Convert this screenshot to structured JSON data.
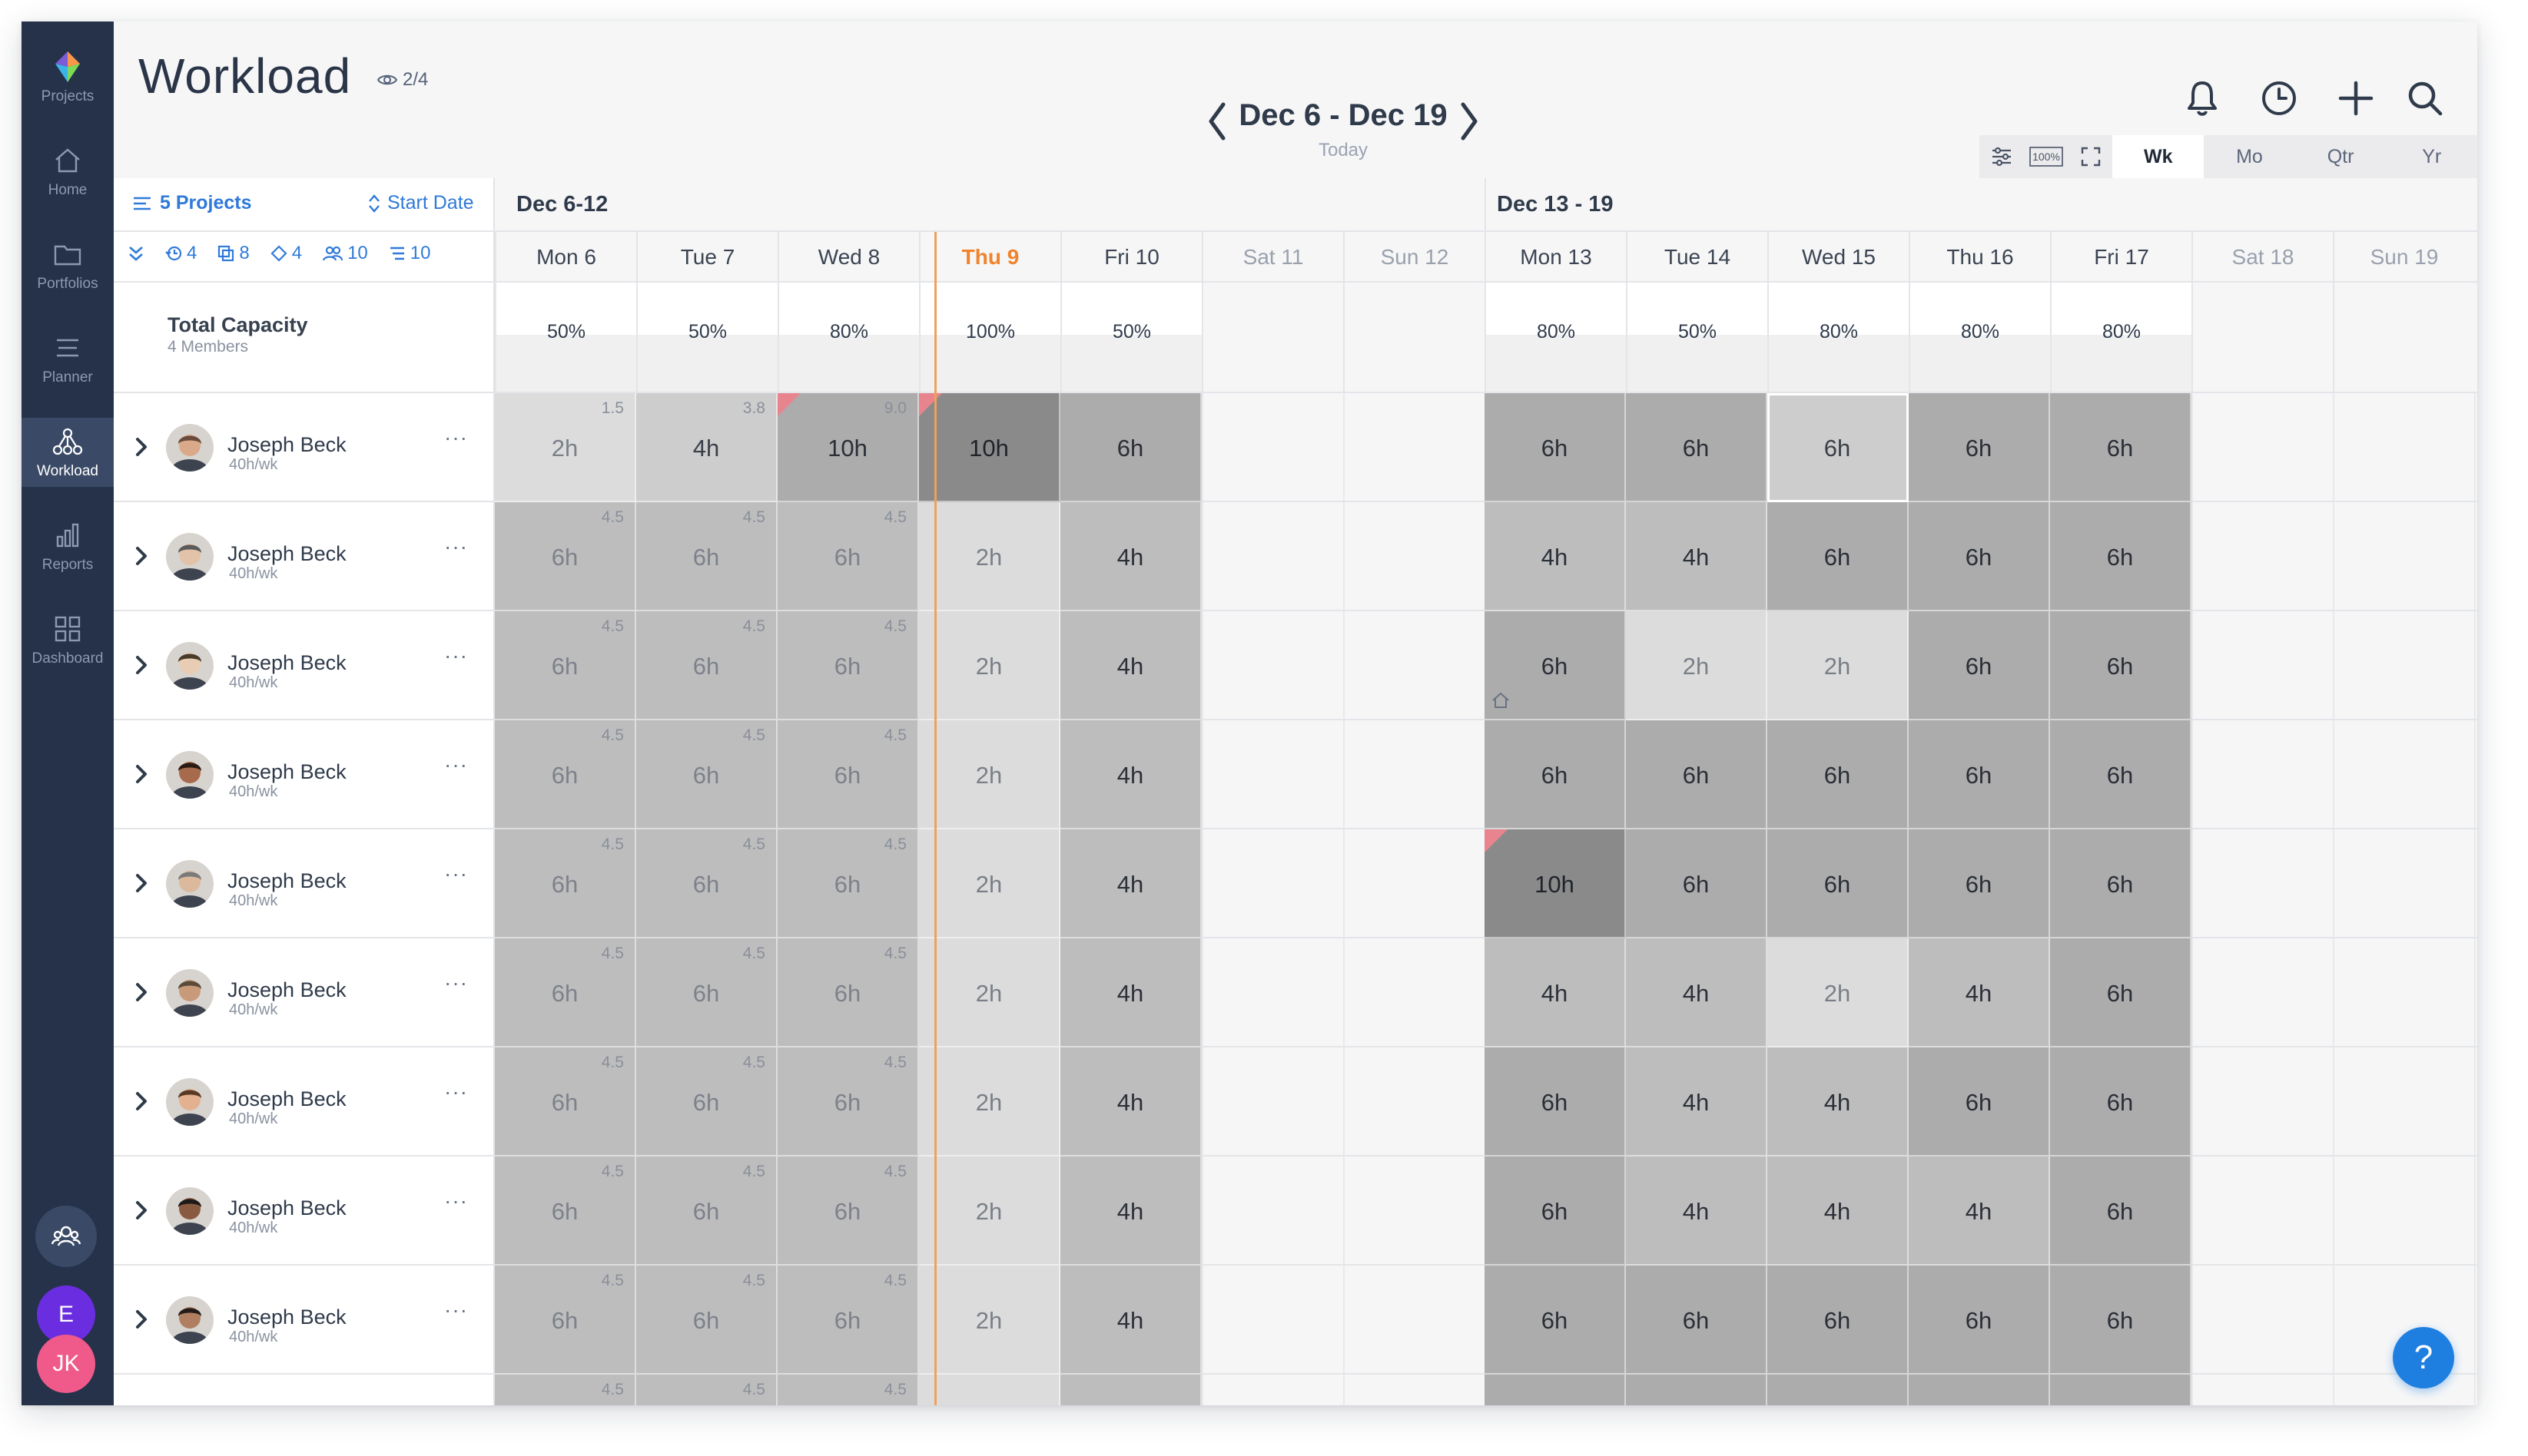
{
  "sidebar": {
    "items": [
      {
        "label": "Projects",
        "icon": "projects-logo-icon"
      },
      {
        "label": "Home",
        "icon": "home-icon"
      },
      {
        "label": "Portfolios",
        "icon": "folder-icon"
      },
      {
        "label": "Planner",
        "icon": "planner-icon"
      },
      {
        "label": "Workload",
        "icon": "workload-icon"
      },
      {
        "label": "Reports",
        "icon": "bar-chart-icon"
      },
      {
        "label": "Dashboard",
        "icon": "dashboard-grid-icon"
      }
    ],
    "active": "Workload",
    "team_icon": "team-icon",
    "user_e": "E",
    "user_jk": "JK"
  },
  "header": {
    "title": "Workload",
    "viewers": "2/4",
    "date_range": "Dec 6 - Dec 19",
    "today": "Today"
  },
  "zoom": {
    "options": [
      "Wk",
      "Mo",
      "Qtr",
      "Yr"
    ],
    "active": "Wk"
  },
  "toolbar": {
    "projects": "5 Projects",
    "sort": "Start Date",
    "chips": [
      "4",
      "8",
      "4",
      "10",
      "10"
    ]
  },
  "capacity": {
    "title": "Total Capacity",
    "subtitle": "4 Members"
  },
  "weeks": [
    "Dec 6-12",
    "Dec 13 - 19"
  ],
  "days": [
    "Mon 6",
    "Tue 7",
    "Wed 8",
    "Thu 9",
    "Fri 10",
    "Sat 11",
    "Sun 12",
    "Mon 13",
    "Tue 14",
    "Wed 15",
    "Thu 16",
    "Fri 17",
    "Sat 18",
    "Sun 19"
  ],
  "today_label": "Thu 9",
  "capacity_values": [
    "50%",
    "50%",
    "80%",
    "100%",
    "50%",
    "",
    "",
    "80%",
    "50%",
    "80%",
    "80%",
    "80%",
    "",
    ""
  ],
  "members": [
    {
      "name": "Joseph Beck",
      "hours": "40h/wk"
    },
    {
      "name": "Joseph Beck",
      "hours": "40h/wk"
    },
    {
      "name": "Joseph Beck",
      "hours": "40h/wk"
    },
    {
      "name": "Joseph Beck",
      "hours": "40h/wk"
    },
    {
      "name": "Joseph Beck",
      "hours": "40h/wk"
    },
    {
      "name": "Joseph Beck",
      "hours": "40h/wk"
    },
    {
      "name": "Joseph Beck",
      "hours": "40h/wk"
    },
    {
      "name": "Joseph Beck",
      "hours": "40h/wk"
    },
    {
      "name": "Joseph Beck",
      "hours": "40h/wk"
    }
  ],
  "rows": [
    {
      "caps": [
        "1.5",
        "3.8",
        "9.0",
        "",
        ""
      ],
      "week1": [
        "2h",
        "4h",
        "10h",
        "10h",
        "6h"
      ],
      "week2": [
        "6h",
        "6h",
        "6h",
        "6h",
        "6h"
      ],
      "shade1": [
        1,
        2,
        4,
        5,
        4
      ],
      "shade2": [
        4,
        4,
        2,
        4,
        4
      ],
      "flags1": [
        false,
        false,
        true,
        true,
        false
      ],
      "flags2": [
        false,
        false,
        false,
        false,
        false
      ]
    },
    {
      "caps": [
        "4.5",
        "4.5",
        "4.5",
        "",
        ""
      ],
      "week1": [
        "6h",
        "6h",
        "6h",
        "2h",
        "4h"
      ],
      "week2": [
        "4h",
        "4h",
        "6h",
        "6h",
        "6h"
      ],
      "shade1": [
        3,
        3,
        3,
        1,
        3
      ],
      "shade2": [
        3,
        3,
        4,
        4,
        4
      ],
      "flags1": [
        false,
        false,
        false,
        false,
        false
      ],
      "flags2": [
        false,
        false,
        false,
        false,
        false
      ]
    },
    {
      "caps": [
        "4.5",
        "4.5",
        "4.5",
        "",
        ""
      ],
      "week1": [
        "6h",
        "6h",
        "6h",
        "2h",
        "4h"
      ],
      "week2": [
        "6h",
        "2h",
        "2h",
        "6h",
        "6h"
      ],
      "shade1": [
        3,
        3,
        3,
        1,
        3
      ],
      "shade2": [
        4,
        1,
        1,
        4,
        4
      ],
      "flags1": [
        false,
        false,
        false,
        false,
        false
      ],
      "flags2": [
        false,
        false,
        false,
        false,
        false
      ]
    },
    {
      "caps": [
        "4.5",
        "4.5",
        "4.5",
        "",
        ""
      ],
      "week1": [
        "6h",
        "6h",
        "6h",
        "2h",
        "4h"
      ],
      "week2": [
        "6h",
        "6h",
        "6h",
        "6h",
        "6h"
      ],
      "shade1": [
        3,
        3,
        3,
        1,
        3
      ],
      "shade2": [
        4,
        4,
        4,
        4,
        4
      ],
      "flags1": [
        false,
        false,
        false,
        false,
        false
      ],
      "flags2": [
        false,
        false,
        false,
        false,
        false
      ]
    },
    {
      "caps": [
        "4.5",
        "4.5",
        "4.5",
        "",
        ""
      ],
      "week1": [
        "6h",
        "6h",
        "6h",
        "2h",
        "4h"
      ],
      "week2": [
        "10h",
        "6h",
        "6h",
        "6h",
        "6h"
      ],
      "shade1": [
        3,
        3,
        3,
        1,
        3
      ],
      "shade2": [
        5,
        4,
        4,
        4,
        4
      ],
      "flags1": [
        false,
        false,
        false,
        false,
        false
      ],
      "flags2": [
        true,
        false,
        false,
        false,
        false
      ]
    },
    {
      "caps": [
        "4.5",
        "4.5",
        "4.5",
        "",
        ""
      ],
      "week1": [
        "6h",
        "6h",
        "6h",
        "2h",
        "4h"
      ],
      "week2": [
        "4h",
        "4h",
        "2h",
        "4h",
        "6h"
      ],
      "shade1": [
        3,
        3,
        3,
        1,
        3
      ],
      "shade2": [
        3,
        3,
        1,
        3,
        4
      ],
      "flags1": [
        false,
        false,
        false,
        false,
        false
      ],
      "flags2": [
        false,
        false,
        false,
        false,
        false
      ]
    },
    {
      "caps": [
        "4.5",
        "4.5",
        "4.5",
        "",
        ""
      ],
      "week1": [
        "6h",
        "6h",
        "6h",
        "2h",
        "4h"
      ],
      "week2": [
        "6h",
        "4h",
        "4h",
        "6h",
        "6h"
      ],
      "shade1": [
        3,
        3,
        3,
        1,
        3
      ],
      "shade2": [
        4,
        3,
        3,
        4,
        4
      ],
      "flags1": [
        false,
        false,
        false,
        false,
        false
      ],
      "flags2": [
        false,
        false,
        false,
        false,
        false
      ]
    },
    {
      "caps": [
        "4.5",
        "4.5",
        "4.5",
        "",
        ""
      ],
      "week1": [
        "6h",
        "6h",
        "6h",
        "2h",
        "4h"
      ],
      "week2": [
        "6h",
        "4h",
        "4h",
        "4h",
        "6h"
      ],
      "shade1": [
        3,
        3,
        3,
        1,
        3
      ],
      "shade2": [
        4,
        3,
        3,
        3,
        4
      ],
      "flags1": [
        false,
        false,
        false,
        false,
        false
      ],
      "flags2": [
        false,
        false,
        false,
        false,
        false
      ]
    },
    {
      "caps": [
        "4.5",
        "4.5",
        "4.5",
        "",
        ""
      ],
      "week1": [
        "6h",
        "6h",
        "6h",
        "2h",
        "4h"
      ],
      "week2": [
        "6h",
        "6h",
        "6h",
        "6h",
        "6h"
      ],
      "shade1": [
        3,
        3,
        3,
        1,
        3
      ],
      "shade2": [
        4,
        4,
        4,
        4,
        4
      ],
      "flags1": [
        false,
        false,
        false,
        false,
        false
      ],
      "flags2": [
        false,
        false,
        false,
        false,
        false
      ]
    },
    {
      "caps": [
        "4.5",
        "4.5",
        "4.5",
        "",
        ""
      ],
      "week1": [
        "",
        "",
        "",
        "",
        ""
      ],
      "week2": [
        "",
        "",
        "",
        "",
        ""
      ],
      "shade1": [
        3,
        3,
        3,
        1,
        3
      ],
      "shade2": [
        4,
        4,
        4,
        4,
        4
      ],
      "flags1": [
        false,
        false,
        false,
        false,
        false
      ],
      "flags2": [
        false,
        false,
        false,
        false,
        false
      ]
    }
  ],
  "help": "?",
  "colors": {
    "sidebar": "#25324a",
    "accent": "#2f7ad9",
    "today": "#f0832b",
    "help": "#1f7fe0",
    "flag": "#e7848e"
  }
}
